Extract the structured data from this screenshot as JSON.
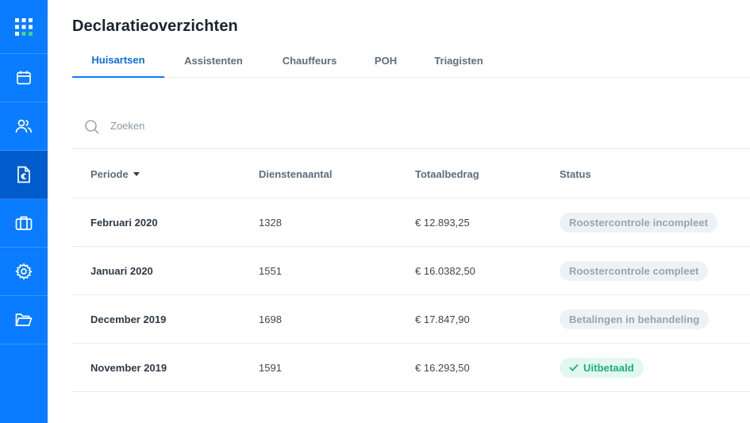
{
  "page": {
    "title": "Declaratieoverzichten"
  },
  "tabs": [
    {
      "label": "Huisartsen"
    },
    {
      "label": "Assistenten"
    },
    {
      "label": "Chauffeurs"
    },
    {
      "label": "POH"
    },
    {
      "label": "Triagisten"
    }
  ],
  "sidebar": {
    "items": [
      {
        "icon": "grid-logo-icon"
      },
      {
        "icon": "calendar-icon"
      },
      {
        "icon": "users-icon"
      },
      {
        "icon": "euro-document-icon",
        "active": true
      },
      {
        "icon": "briefcase-icon"
      },
      {
        "icon": "gear-icon"
      },
      {
        "icon": "folder-open-icon"
      }
    ]
  },
  "search": {
    "placeholder": "Zoeken"
  },
  "table": {
    "headers": [
      "Periode",
      "Dienstenaantal",
      "Totaalbedrag",
      "Status"
    ],
    "rows": [
      {
        "period": "Februari 2020",
        "count": "1328",
        "total": "€ 12.893,25",
        "status": "Roostercontrole incompleet"
      },
      {
        "period": "Januari 2020",
        "count": "1551",
        "total": "€ 16.0382,50",
        "status": "Roostercontrole compleet"
      },
      {
        "period": "December 2019",
        "count": "1698",
        "total": "€ 17.847,90",
        "status": "Betalingen in behandeling"
      },
      {
        "period": "November 2019",
        "count": "1591",
        "total": "€ 16.293,50",
        "status": "Uitbetaald"
      }
    ]
  },
  "colors": {
    "sidebar": "#0a7cff",
    "sidebar_active": "#005ccc",
    "accent": "#0a7cff",
    "paid": "#17b079",
    "logo_green": "#39d98a"
  }
}
